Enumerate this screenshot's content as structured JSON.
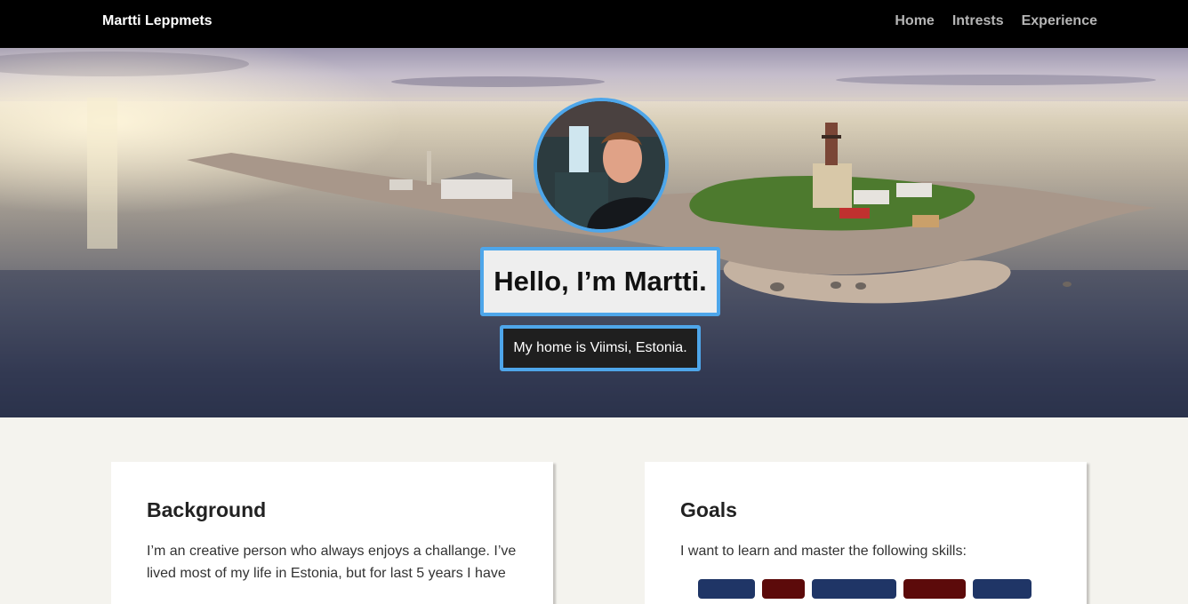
{
  "nav": {
    "brand": "Martti Leppmets",
    "links": [
      "Home",
      "Intrests",
      "Experience"
    ]
  },
  "hero": {
    "title": "Hello, I’m Martti.",
    "subtitle": "My home is Viimsi, Estonia."
  },
  "background": {
    "heading": "Background",
    "text": "I’m an creative person who always enjoys a challange. I’ve lived most of my life in Estonia, but for last 5 years I have"
  },
  "goals": {
    "heading": "Goals",
    "text": "I want to learn and master the following skills:",
    "skills": [
      {
        "label": "",
        "color": "#1f3566"
      },
      {
        "label": "",
        "color": "#5c0a0a"
      },
      {
        "label": "",
        "color": "#1f3566"
      },
      {
        "label": "",
        "color": "#5c0a0a"
      },
      {
        "label": "",
        "color": "#1f3566"
      }
    ]
  },
  "colors": {
    "accent": "#4ea6ea",
    "navbar": "#000000",
    "page_background": "#f4f3ee"
  }
}
